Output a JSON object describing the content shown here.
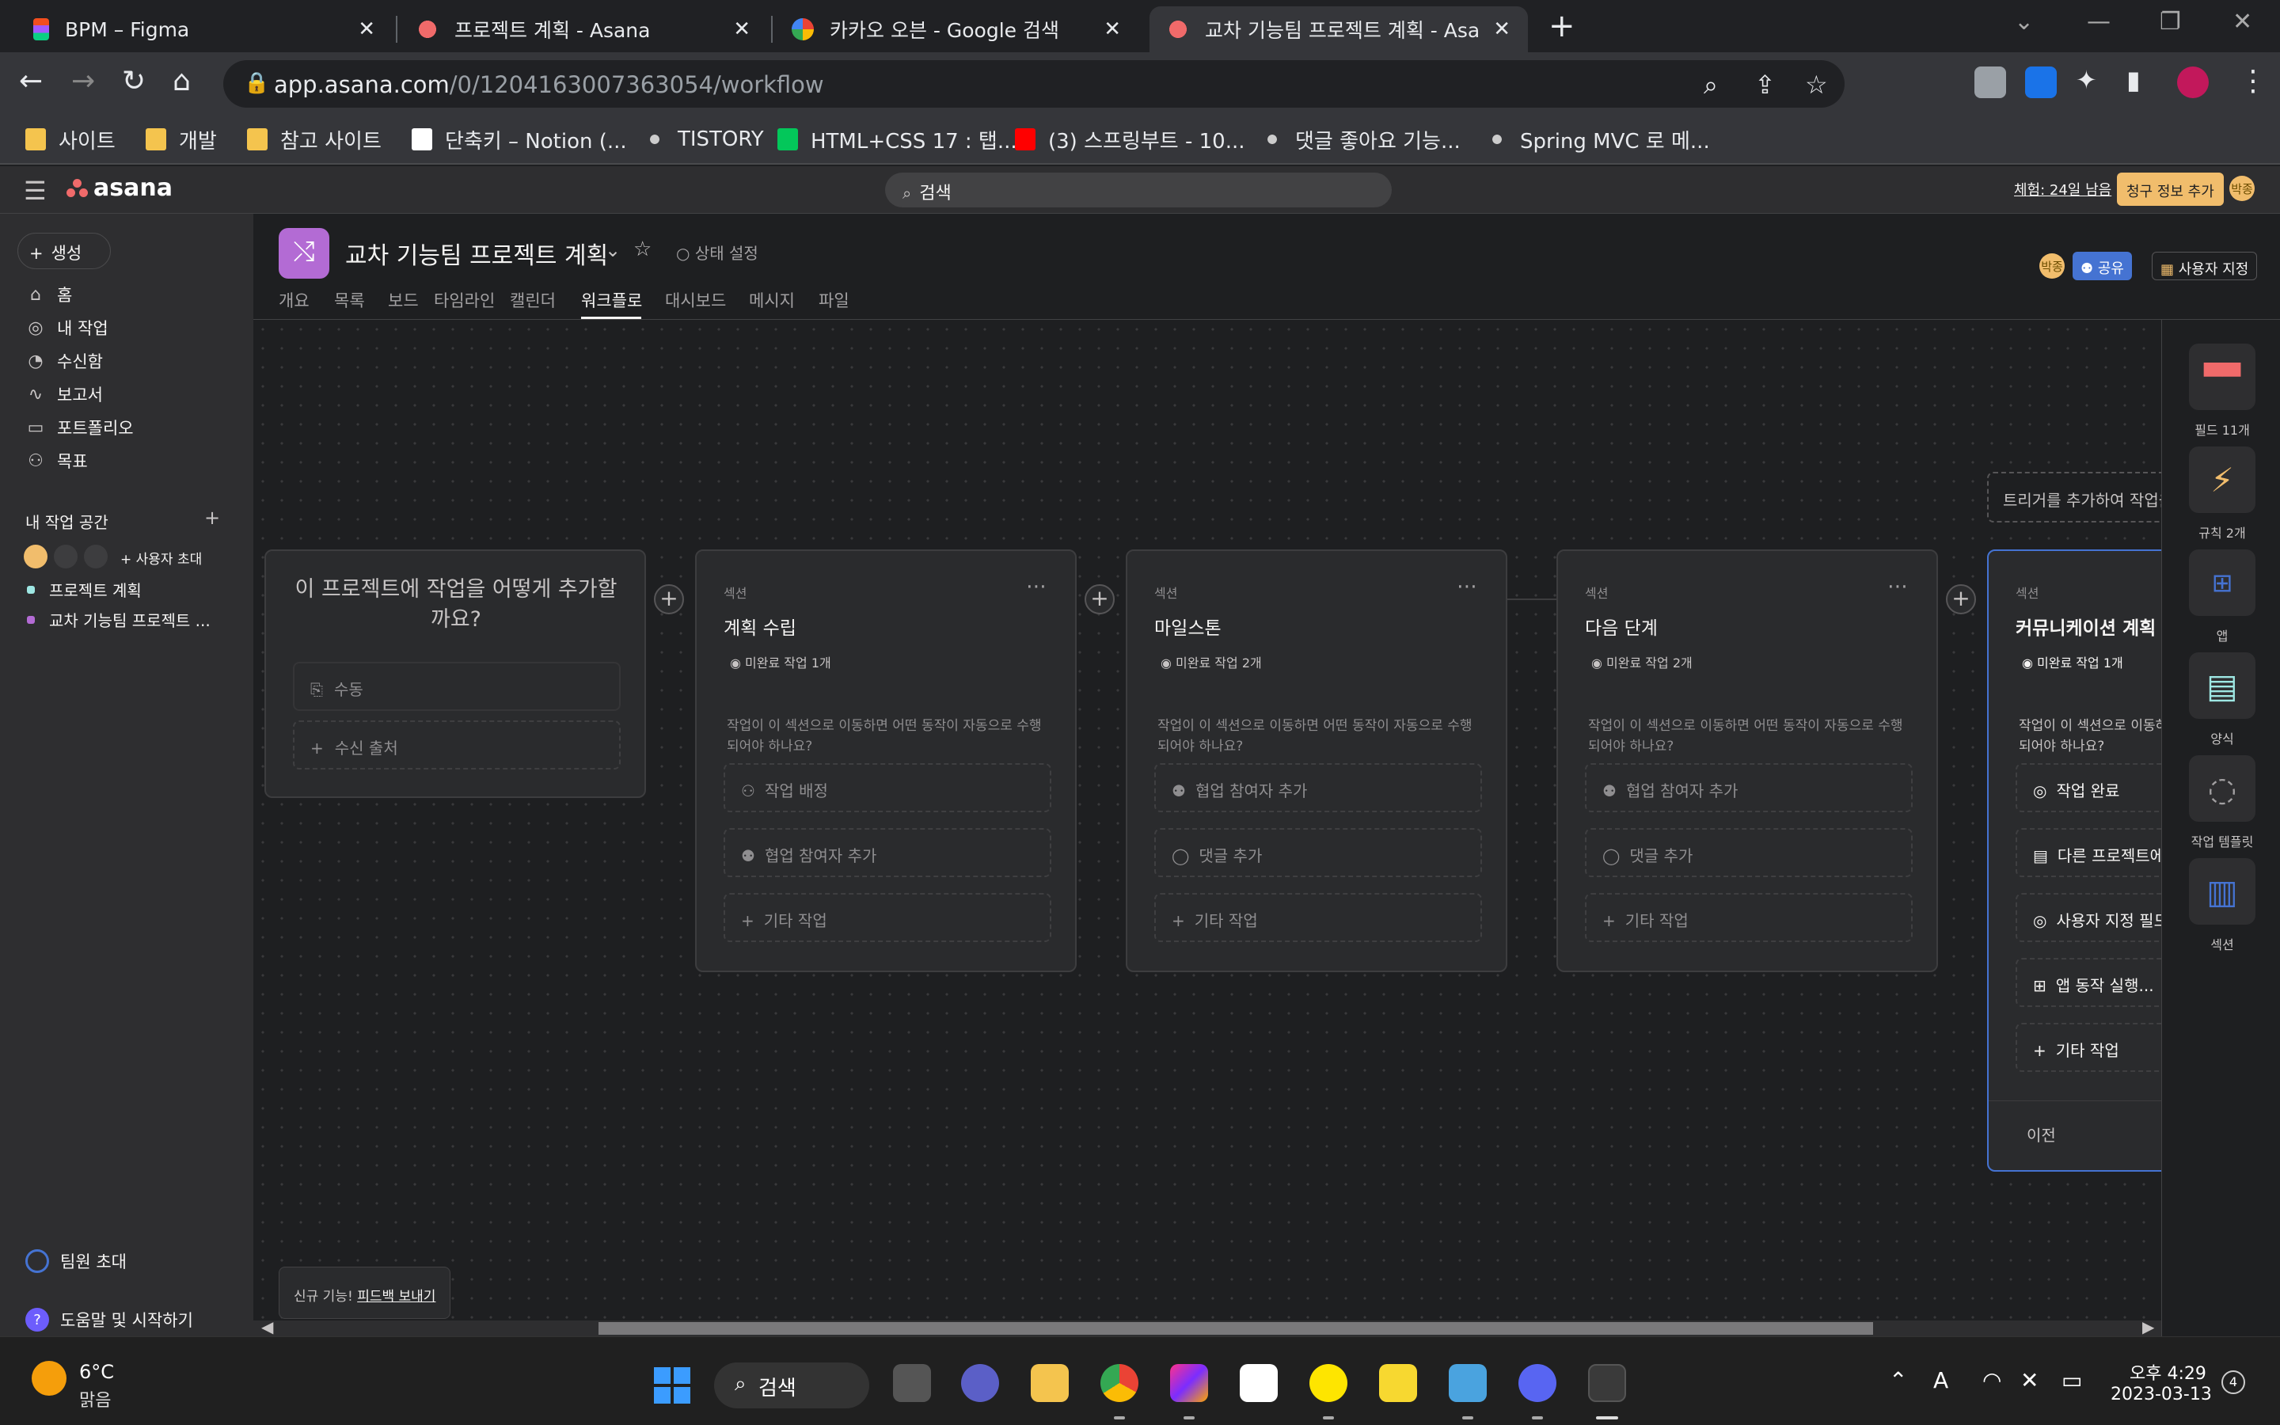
{
  "browser": {
    "tabs": [
      {
        "title": "BPM – Figma",
        "icon": "figma-icon"
      },
      {
        "title": "프로젝트 계획 - Asana",
        "icon": "asana-icon"
      },
      {
        "title": "카카오 오븐 - Google 검색",
        "icon": "google-icon"
      },
      {
        "title": "교차 기능팀 프로젝트 계획 - Asa",
        "icon": "asana-icon",
        "active": true
      }
    ],
    "url_host": "app.asana.com",
    "url_path": "/0/1204163007363054/workflow",
    "bookmarks": [
      "사이트",
      "개발",
      "참고 사이트",
      "단축키 – Notion (...",
      "TISTORY",
      "HTML+CSS 17 : 탭...",
      "(3) 스프링부트 - 10...",
      "댓글 좋아요 기능...",
      "Spring MVC 로 메..."
    ]
  },
  "asana": {
    "logo": "asana",
    "search_placeholder": "검색",
    "trial": "체험: 24일 남음",
    "billing_button": "청구 정보 추가",
    "user_initials": "박종",
    "sidebar": {
      "create": "생성",
      "nav": [
        "홈",
        "내 작업",
        "수신함",
        "보고서",
        "포트폴리오",
        "목표"
      ],
      "workspace_title": "내 작업 공간",
      "invite_mini": "사용자 초대",
      "projects": [
        {
          "name": "프로젝트 계획",
          "color": "#9ee7e3"
        },
        {
          "name": "교차 기능팀 프로젝트 ...",
          "color": "#b36bd4"
        }
      ],
      "team_invite": "팀원 초대",
      "help": "도움말 및 시작하기"
    },
    "project": {
      "title": "교차 기능팀 프로젝트 계획",
      "status": "상태 설정",
      "tabs": [
        "개요",
        "목록",
        "보드",
        "타임라인",
        "캘린더",
        "워크플로",
        "대시보드",
        "메시지",
        "파일"
      ],
      "active_tab": "워크플로",
      "share": "공유",
      "customize": "사용자 지정"
    },
    "workflow": {
      "intro": {
        "question": "이 프로젝트에 작업을 어떻게 추가할까요?",
        "manual": "수동",
        "add_source": "수신 출처"
      },
      "trigger_hint": "트리거를 추가하여 작업을",
      "sections": [
        {
          "label": "섹션",
          "title": "계획 수립",
          "badge": "미완료 작업 1개",
          "question": "작업이 이 섹션으로 이동하면 어떤 동작이 자동으로 수행되어야 하나요?",
          "actions": [
            "작업 배정",
            "협업 참여자 추가",
            "기타 작업"
          ]
        },
        {
          "label": "섹션",
          "title": "마일스톤",
          "badge": "미완료 작업 2개",
          "question": "작업이 이 섹션으로 이동하면 어떤 동작이 자동으로 수행되어야 하나요?",
          "actions": [
            "협업 참여자 추가",
            "댓글 추가",
            "기타 작업"
          ]
        },
        {
          "label": "섹션",
          "title": "다음 단계",
          "badge": "미완료 작업 2개",
          "question": "작업이 이 섹션으로 이동하면 어떤 동작이 자동으로 수행되어야 하나요?",
          "actions": [
            "협업 참여자 추가",
            "댓글 추가",
            "기타 작업"
          ]
        },
        {
          "label": "섹션",
          "title": "커뮤니케이션 계획",
          "badge": "미완료 작업 1개",
          "question": "작업이 이 섹션으로 이동하면 어떤 동작이 자동으로 수행되어야 하나요?",
          "actions": [
            "작업 완료",
            "다른 프로젝트에",
            "사용자 지정 필드",
            "앱 동작 실행...",
            "기타 작업"
          ],
          "back": "이전"
        }
      ],
      "feedback_prefix": "신규 기능!",
      "feedback_link": "피드백 보내기"
    },
    "right_panel": [
      "필드 11개",
      "규칙 2개",
      "앱",
      "양식",
      "작업 템플릿",
      "섹션"
    ]
  },
  "taskbar": {
    "temperature": "6°C",
    "condition": "맑음",
    "search": "검색",
    "time": "오후 4:29",
    "date": "2023-03-13",
    "notifications": "4"
  },
  "colors": {
    "accent": "#4573d2",
    "asana_coral": "#f06a6a",
    "project_purple": "#b36bd4"
  }
}
